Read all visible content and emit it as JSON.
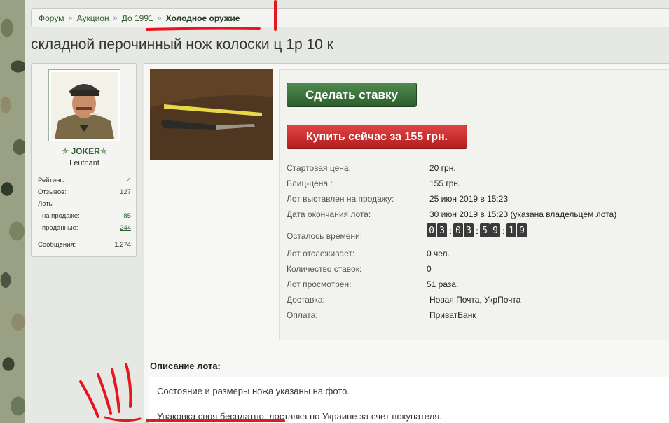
{
  "breadcrumb": [
    {
      "label": "Форум"
    },
    {
      "label": "Аукцион"
    },
    {
      "label": "До 1991"
    },
    {
      "label": "Холодное оружие"
    }
  ],
  "title": "складной перочинный нож колоски ц 1р 10 к",
  "user": {
    "name": "✮ JOKER✮",
    "rank": "Leutnant",
    "stats": {
      "rating_label": "Рейтинг:",
      "rating": "4",
      "reviews_label": "Отзывов:",
      "reviews": "127",
      "lots_label": "Лоты",
      "on_sale_label": "на продаже:",
      "on_sale": "85",
      "sold_label": "проданные:",
      "sold": "244",
      "messages_label": "Сообщения:",
      "messages": "1.274"
    }
  },
  "buttons": {
    "bid": "Сделать ставку",
    "buy_now": "Купить сейчас за 155 грн."
  },
  "details": {
    "start_price_label": "Стартовая цена:",
    "start_price": "20 грн.",
    "blitz_price_label": "Блиц-цена :",
    "blitz_price": "155 грн.",
    "listed_label": "Лот выставлен на продажу:",
    "listed": "25 июн 2019 в 15:23",
    "end_label": "Дата окончания лота:",
    "end": "30 июн 2019 в 15:23 (указана владельцем лота)",
    "remaining_label": "Осталось времени:",
    "timer": [
      "0",
      "3",
      "0",
      "3",
      "5",
      "9",
      "1",
      "9"
    ],
    "watchers_label": "Лот отслеживает:",
    "watchers": "0 чел.",
    "bids_label": "Количество ставок:",
    "bids": "0",
    "views_label": "Лот просмотрен:",
    "views": "51 раза.",
    "delivery_label": "Доставка:",
    "delivery": "Новая Почта, УкрПочта",
    "payment_label": "Оплата:",
    "payment": "ПриватБанк"
  },
  "description": {
    "heading": "Описание лота:",
    "line1": "Состояние и размеры ножа указаны на фото.",
    "line2": "Упаковка своя бесплатно, доставка по Украине за счет покупателя."
  },
  "colors": {
    "link_green": "#2d5e2d",
    "bid_button": "#2c5e2c",
    "buy_button": "#b41e1e",
    "annotation_red": "#e8141e"
  }
}
